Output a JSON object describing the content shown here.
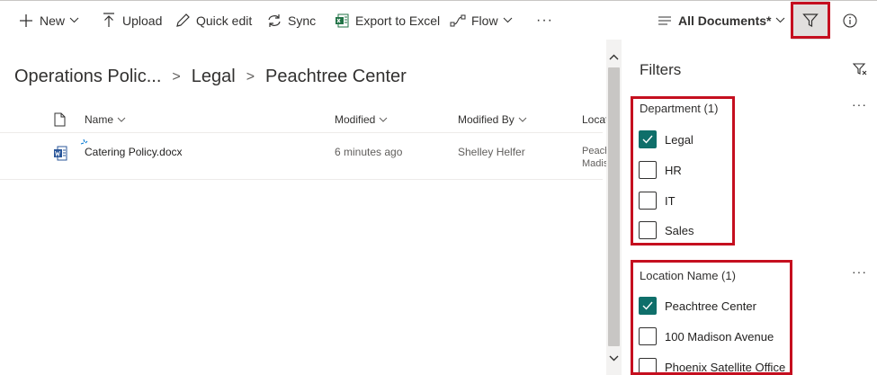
{
  "toolbar": {
    "new_label": "New",
    "upload_label": "Upload",
    "quick_edit_label": "Quick edit",
    "sync_label": "Sync",
    "export_label": "Export to Excel",
    "flow_label": "Flow",
    "more_label": "···",
    "view_label": "All Documents*"
  },
  "breadcrumb": {
    "items": [
      "Operations Polic...",
      "Legal",
      "Peachtree Center"
    ],
    "separator": ">"
  },
  "list": {
    "columns": [
      "Name",
      "Modified",
      "Modified By",
      "Locati"
    ],
    "rows": [
      {
        "name": "Catering Policy.docx",
        "modified": "6 minutes ago",
        "modified_by": "Shelley Helfer",
        "location_line1": "Peach",
        "location_line2": "Madis"
      }
    ]
  },
  "filters": {
    "title": "Filters",
    "more_label": "···",
    "groups": [
      {
        "title": "Department (1)",
        "options": [
          {
            "label": "Legal",
            "checked": true
          },
          {
            "label": "HR",
            "checked": false
          },
          {
            "label": "IT",
            "checked": false
          },
          {
            "label": "Sales",
            "checked": false
          }
        ]
      },
      {
        "title": "Location Name (1)",
        "options": [
          {
            "label": "Peachtree Center",
            "checked": true
          },
          {
            "label": "100 Madison Avenue",
            "checked": false
          },
          {
            "label": "Phoenix Satellite Office",
            "checked": false
          }
        ]
      }
    ]
  },
  "colors": {
    "checked": "#0f6f6a",
    "highlight": "#c50f1f",
    "word_blue": "#2b579a",
    "excel_green": "#217346",
    "accent_blue": "#0078d4"
  },
  "icons": [
    "plus-icon",
    "upload-icon",
    "pencil-icon",
    "sync-icon",
    "excel-icon",
    "flow-icon",
    "filter-icon",
    "info-icon",
    "document-icon",
    "word-file-icon",
    "clear-filter-icon"
  ]
}
